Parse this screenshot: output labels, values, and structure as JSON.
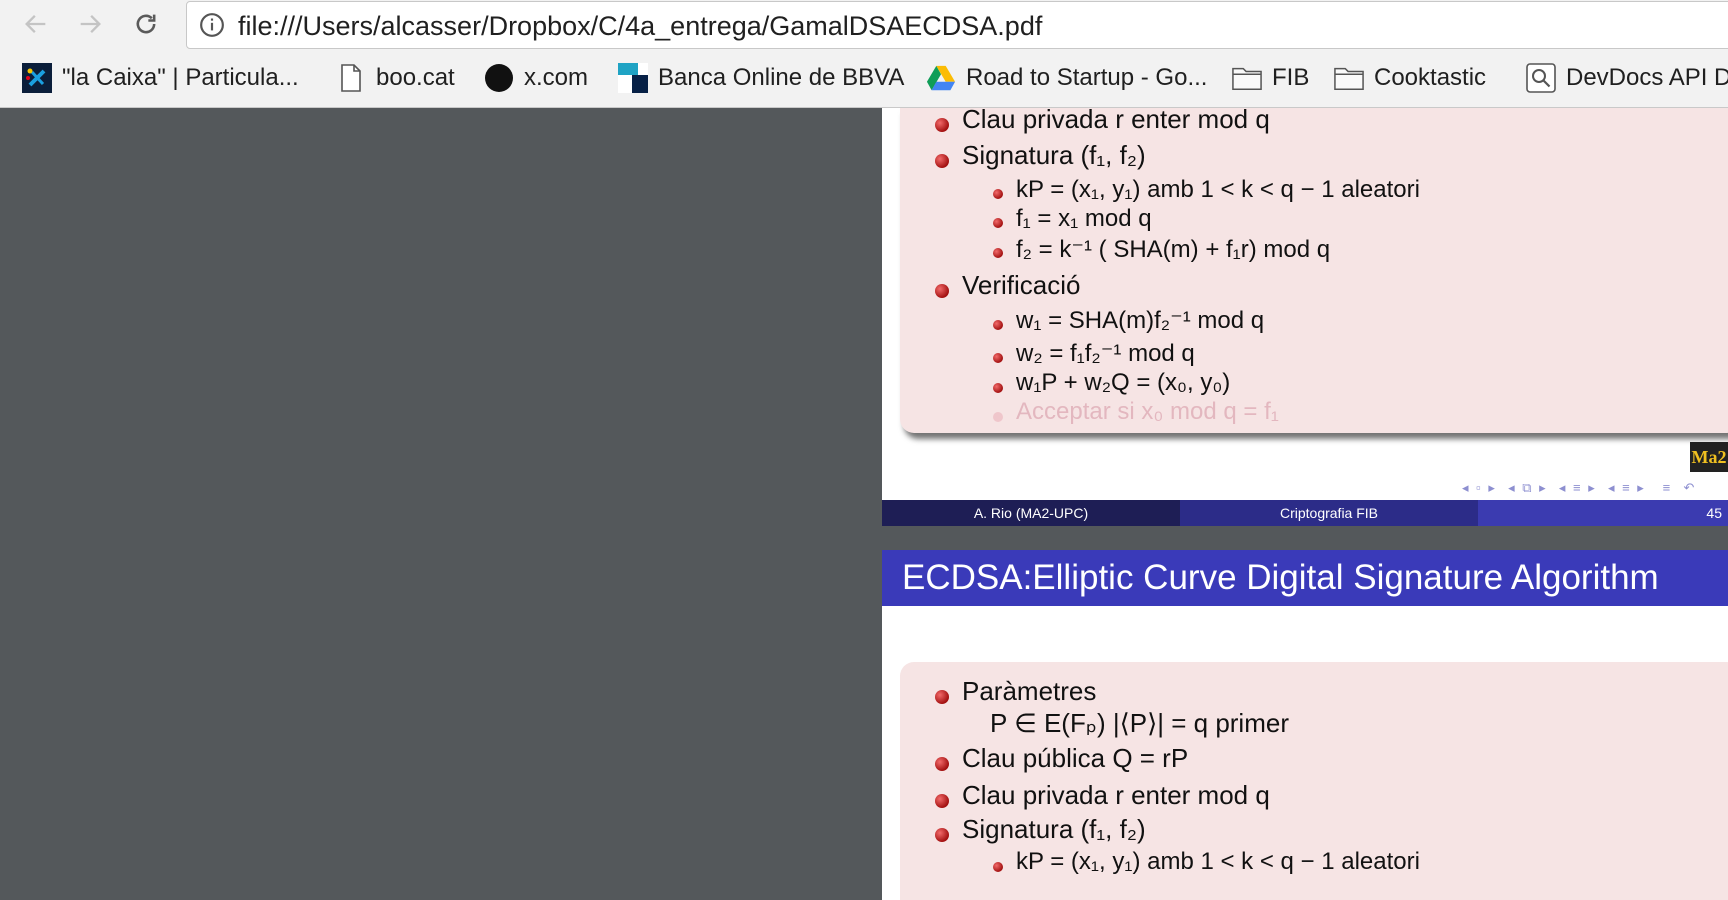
{
  "browser": {
    "url": "file:///Users/alcasser/Dropbox/C/4a_entrega/GamalDSAECDSA.pdf",
    "bookmarks": [
      {
        "label": "\"la Caixa\" | Particula...",
        "icon": "lacaixa-icon"
      },
      {
        "label": "boo.cat",
        "icon": "page-icon"
      },
      {
        "label": "x.com",
        "icon": "circle-icon"
      },
      {
        "label": "Banca Online de BBVA",
        "icon": "bbva-icon"
      },
      {
        "label": "Road to Startup - Go...",
        "icon": "drive-icon"
      },
      {
        "label": "FIB",
        "icon": "folder-icon"
      },
      {
        "label": "Cooktastic",
        "icon": "folder-icon"
      },
      {
        "label": "DevDocs API D",
        "icon": "search-icon"
      }
    ]
  },
  "slide1": {
    "items": [
      {
        "text": "Clau privada r enter mod q",
        "level": 1
      },
      {
        "text": "Signatura (f₁, f₂)",
        "level": 1
      },
      {
        "text": "kP = (x₁, y₁) amb 1 < k < q − 1 aleatori",
        "level": 2
      },
      {
        "text": "f₁ = x₁ mod q",
        "level": 2
      },
      {
        "text": "f₂ = k⁻¹ ( SHA(m) + f₁r) mod q",
        "level": 2
      },
      {
        "text": "Verificació",
        "level": 1
      },
      {
        "text": "w₁ = SHA(m)f₂⁻¹ mod q",
        "level": 2
      },
      {
        "text": "w₂ = f₁f₂⁻¹ mod q",
        "level": 2
      },
      {
        "text": "w₁P + w₂Q = (x₀, y₀)",
        "level": 2
      },
      {
        "text": "Acceptar si x₀ mod q = f₁",
        "level": 2,
        "faded": true
      }
    ],
    "footer": {
      "author": "A. Rio  (MA2-UPC)",
      "course": "Criptografia FIB",
      "page": "45"
    },
    "logo": "Ma2"
  },
  "slide2": {
    "title": "ECDSA:Elliptic Curve Digital Signature Algorithm",
    "items": [
      {
        "text": "Paràmetres",
        "level": 1
      },
      {
        "text": "P ∈ E(Fₚ)   |⟨P⟩| = q primer",
        "level": 0
      },
      {
        "text": "Clau pública Q = rP",
        "level": 1
      },
      {
        "text": "Clau privada r enter mod q",
        "level": 1
      },
      {
        "text": "Signatura (f₁, f₂)",
        "level": 1
      },
      {
        "text": "kP = (x₁, y₁) amb 1 < k < q − 1 aleatori",
        "level": 2
      }
    ]
  }
}
